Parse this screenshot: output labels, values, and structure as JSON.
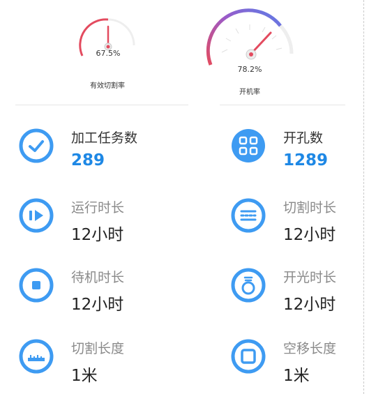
{
  "gauges": [
    {
      "value": "67.5%",
      "label": "有效切割率",
      "fraction": 0.675,
      "color": "#e34b5f"
    },
    {
      "value": "78.2%",
      "label": "开机率",
      "fraction": 0.782,
      "color": "#e34b5f"
    }
  ],
  "stats": [
    {
      "label": "加工任务数",
      "value": "289",
      "icon": "check-icon"
    },
    {
      "label": "开孔数",
      "value": "1289",
      "icon": "grid-holes-icon"
    },
    {
      "label": "运行时长",
      "value": "12小时",
      "icon": "play-icon"
    },
    {
      "label": "切割时长",
      "value": "12小时",
      "icon": "lines-icon"
    },
    {
      "label": "待机时长",
      "value": "12小时",
      "icon": "stop-icon"
    },
    {
      "label": "开光时长",
      "value": "12小时",
      "icon": "bulb-icon"
    },
    {
      "label": "切割长度",
      "value": "1米",
      "icon": "ruler-icon"
    },
    {
      "label": "空移长度",
      "value": "1米",
      "icon": "square-icon"
    }
  ],
  "colors": {
    "accent": "#3e9bf2",
    "value_blue": "#1e88e5",
    "gauge_red": "#e34b5f",
    "gauge_blue": "#6a6ee0"
  }
}
